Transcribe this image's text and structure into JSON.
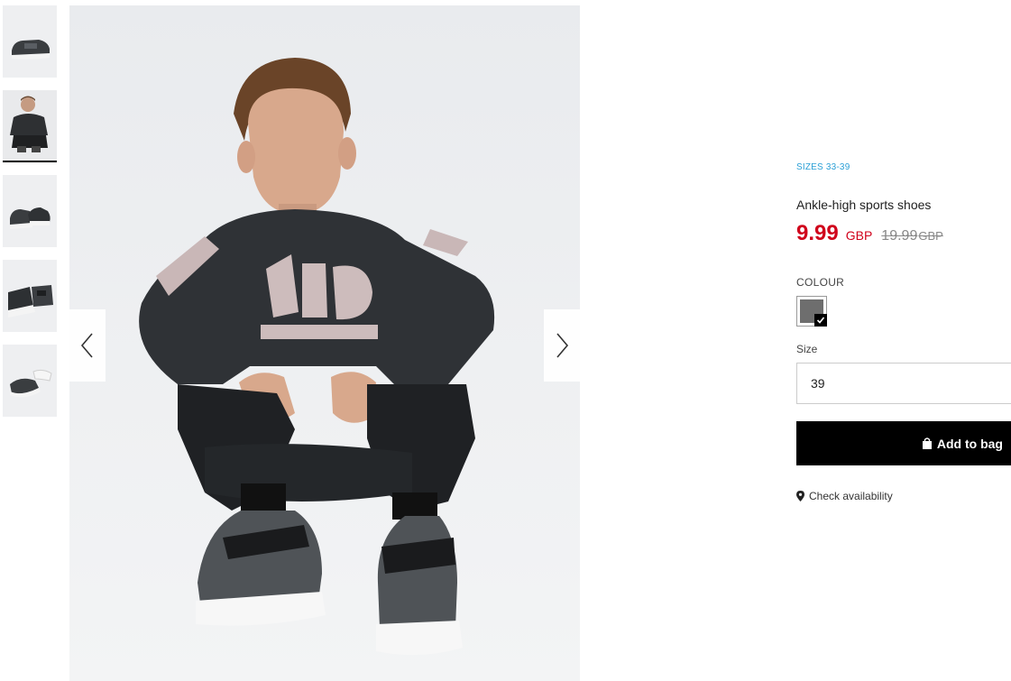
{
  "gallery": {
    "thumbnails": [
      {
        "name": "shoe-side-view"
      },
      {
        "name": "model-sitting-view"
      },
      {
        "name": "shoe-pair-view"
      },
      {
        "name": "shoe-back-view"
      },
      {
        "name": "shoe-top-view"
      }
    ],
    "active_index": 1,
    "prev_icon": "chevron-left-icon",
    "next_icon": "chevron-right-icon"
  },
  "product": {
    "sizes_tag": "SIZES 33-39",
    "name": "Ankle-high sports shoes",
    "price": "9.99",
    "currency": "GBP",
    "old_price": "19.99",
    "old_currency": "GBP",
    "colour_label": "COLOUR",
    "colour_swatch": "#6e6e6e",
    "size_label": "Size",
    "size_value": "39",
    "add_to_bag": "Add to bag",
    "check_availability": "Check availability"
  },
  "colors": {
    "sale": "#d0021b",
    "accent": "#2a9fd6",
    "button_bg": "#000000"
  }
}
